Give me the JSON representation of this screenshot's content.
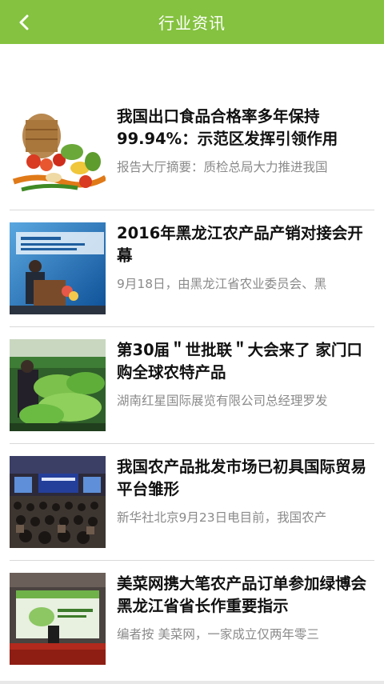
{
  "header": {
    "title": "行业资讯",
    "back_icon": "chevron-left-icon",
    "bg_color": "#84c23f"
  },
  "articles": [
    {
      "title": "我国出口食品合格率多年保持99.94%：示范区发挥引领作用",
      "summary": "报告大厅摘要：质检总局大力推进我国",
      "thumb": "vegetable-basket-photo"
    },
    {
      "title": "2016年黑龙江农产品产销对接会开幕",
      "summary": "9月18日，由黑龙江省农业委员会、黑",
      "thumb": "conference-speaker-photo"
    },
    {
      "title": "第30届＂世批联＂大会来了 家门口购全球农特产品",
      "summary": "湖南红星国际展览有限公司总经理罗发",
      "thumb": "produce-market-photo"
    },
    {
      "title": "我国农产品批发市场已初具国际贸易平台雏形",
      "summary": "新华社北京9月23日电目前，我国农产",
      "thumb": "conference-hall-photo"
    },
    {
      "title": "美菜网携大笔农产品订单参加绿博会 黑龙江省省长作重要指示",
      "summary": "编者按 美菜网，一家成立仅两年零三",
      "thumb": "expo-stage-photo"
    }
  ]
}
